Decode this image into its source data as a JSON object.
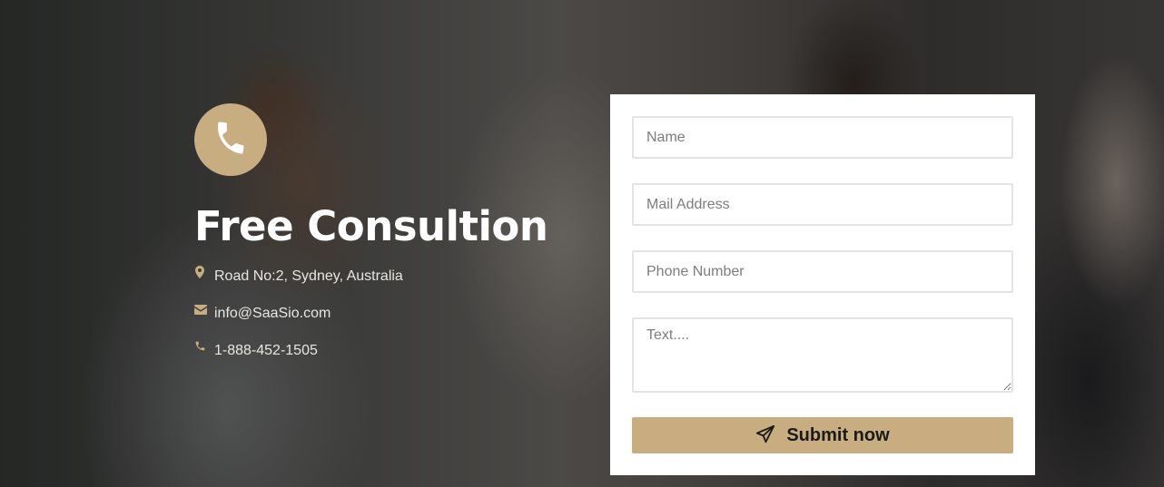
{
  "colors": {
    "accent": "#c8ad80",
    "title": "#ffffff",
    "form_background": "#ffffff",
    "field_border": "#e4e4e4"
  },
  "hero": {
    "icon": "phone-icon",
    "title": "Free Consultion"
  },
  "contact": {
    "items": [
      {
        "icon": "map-marker-icon",
        "text": "Road No:2, Sydney, Australia"
      },
      {
        "icon": "envelope-icon",
        "text": "info@SaaSio.com"
      },
      {
        "icon": "phone-small-icon",
        "text": "1-888-452-1505"
      }
    ]
  },
  "form": {
    "name_placeholder": "Name",
    "name_value": "",
    "mail_placeholder": "Mail Address",
    "mail_value": "",
    "phone_placeholder": "Phone Number",
    "phone_value": "",
    "text_placeholder": "Text....",
    "text_value": "",
    "submit_icon": "paper-plane-icon",
    "submit_label": "Submit now"
  }
}
